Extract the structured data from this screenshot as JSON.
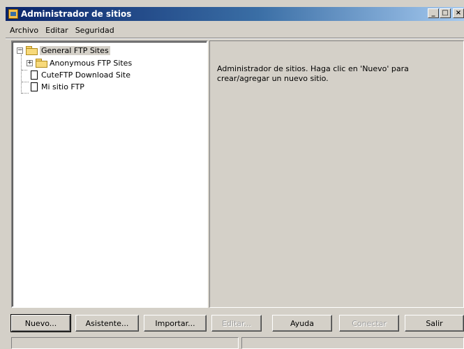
{
  "window": {
    "title": "Administrador de sitios",
    "controls": {
      "minimize": "_",
      "maximize": "□",
      "close": "×"
    }
  },
  "menu": [
    "Archivo",
    "Editar",
    "Seguridad"
  ],
  "tree": {
    "root": {
      "label": "General FTP Sites",
      "expander": "−",
      "icon": "folder-open-icon"
    },
    "children": [
      {
        "label": "Anonymous FTP Sites",
        "expander": "+",
        "icon": "folder-icon"
      },
      {
        "label": "CuteFTP Download Site",
        "icon": "file-icon"
      },
      {
        "label": "Mi sitio FTP",
        "icon": "file-icon"
      }
    ]
  },
  "info": {
    "text": "Administrador de sitios. Haga clic en 'Nuevo' para crear/agregar un nuevo sitio."
  },
  "buttons": {
    "nuevo": "Nuevo...",
    "asistente": "Asistente...",
    "importar": "Importar...",
    "editar": "Editar...",
    "ayuda": "Ayuda",
    "conectar": "Conectar",
    "salir": "Salir"
  },
  "status": {
    "left": "",
    "right": ""
  }
}
